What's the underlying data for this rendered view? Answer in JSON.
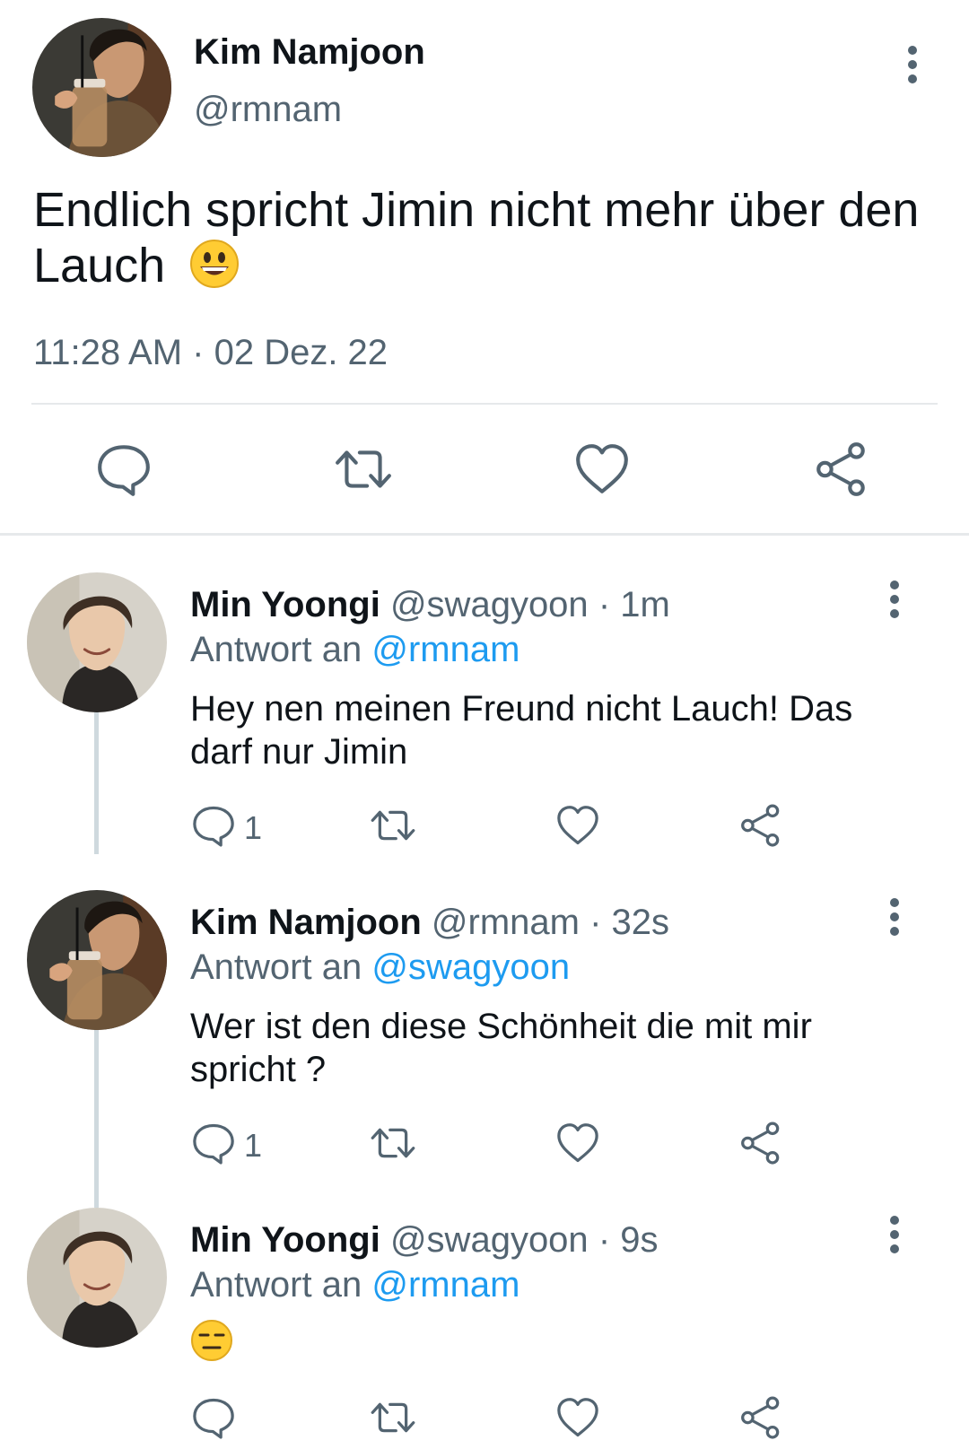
{
  "main_tweet": {
    "author_name": "Kim Namjoon",
    "author_handle": "@rmnam",
    "text": "Endlich spricht Jimin nicht mehr über den Lauch",
    "emoji": "grinning-face",
    "timestamp": "11:28 AM · 02 Dez. 22"
  },
  "replies": [
    {
      "author_name": "Min Yoongi",
      "author_handle": "@swagyoon",
      "time": "· 1m",
      "reply_label": "Antwort an",
      "reply_to": "@rmnam",
      "text": "Hey nen meinen Freund nicht Lauch! Das darf nur Jimin",
      "reply_count": "1",
      "avatar": "min-yoongi"
    },
    {
      "author_name": "Kim Namjoon",
      "author_handle": "@rmnam",
      "time": "· 32s",
      "reply_label": "Antwort an",
      "reply_to": "@swagyoon",
      "text": "Wer ist den diese Schönheit die mit mir spricht ?",
      "reply_count": "1",
      "avatar": "kim-namjoon"
    },
    {
      "author_name": "Min Yoongi",
      "author_handle": "@swagyoon",
      "time": "· 9s",
      "reply_label": "Antwort an",
      "reply_to": "@rmnam",
      "text": "",
      "emoji": "expressionless-face",
      "reply_count": "",
      "avatar": "min-yoongi"
    }
  ],
  "colors": {
    "text_primary": "#0f1419",
    "text_secondary": "#536471",
    "accent_link": "#1d9bf0",
    "divider": "#e6e9eb",
    "icon": "#536471"
  },
  "icons": [
    "comment-icon",
    "retweet-icon",
    "like-icon",
    "share-icon",
    "more-options-icon"
  ]
}
